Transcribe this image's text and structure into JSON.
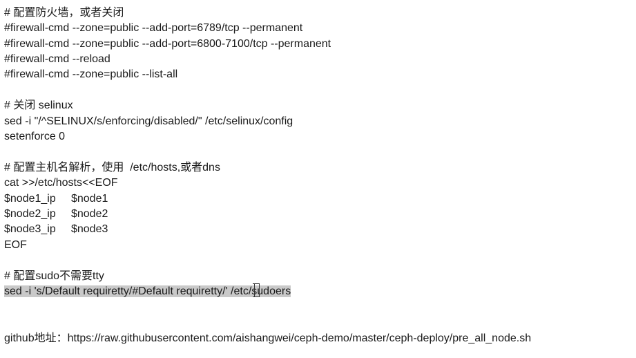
{
  "lines": [
    "# 配置防火墙，或者关闭",
    "#firewall-cmd --zone=public --add-port=6789/tcp --permanent",
    "#firewall-cmd --zone=public --add-port=6800-7100/tcp --permanent",
    "#firewall-cmd --reload",
    "#firewall-cmd --zone=public --list-all",
    "",
    "# 关闭 selinux",
    "sed -i \"/^SELINUX/s/enforcing/disabled/\" /etc/selinux/config",
    "setenforce 0",
    "",
    "# 配置主机名解析，使用  /etc/hosts,或者dns",
    "cat >>/etc/hosts<<EOF",
    "$node1_ip     $node1",
    "$node2_ip     $node2",
    "$node3_ip     $node3",
    "EOF",
    "",
    "# 配置sudo不需要tty",
    "sed -i 's/Default requiretty/#Default requiretty/' /etc/sudoers",
    "",
    "",
    "github地址：https://raw.githubusercontent.com/aishangwei/ceph-demo/master/ceph-deploy/pre_all_node.sh"
  ]
}
